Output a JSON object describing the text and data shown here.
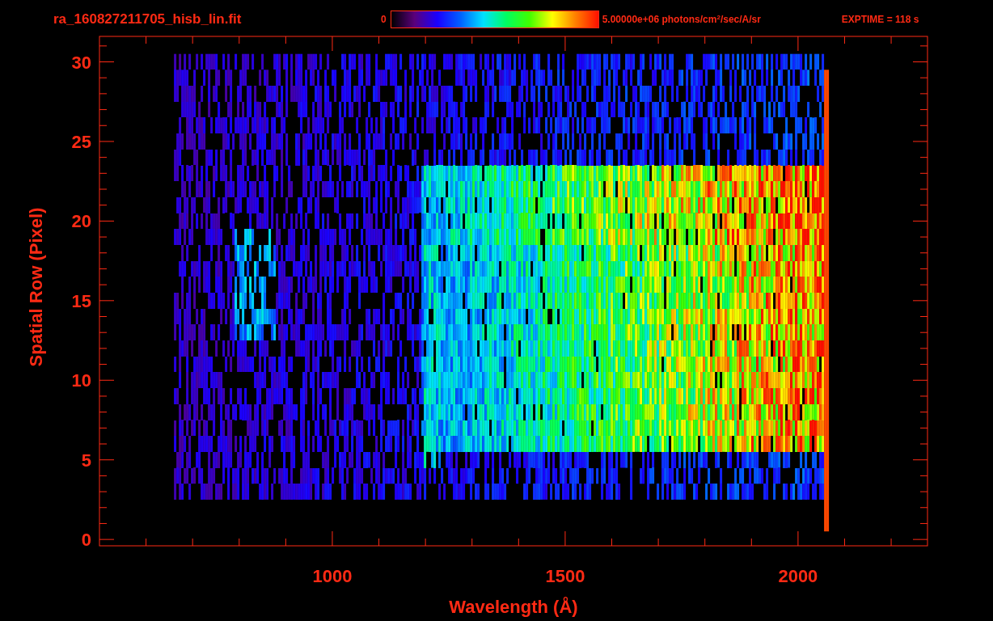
{
  "title": "ra_160827211705_hisb_lin.fit",
  "colorbar": {
    "min_label": "0",
    "max_label": "5.00000e+06 photons/cm$^{2}$/sec/A/sr"
  },
  "exposure": "EXPTIME = 118 s",
  "plot": {
    "xlabel": "Wavelength (Å)",
    "ylabel": "Spatial Row (Pixel)",
    "xtick_labels": [
      "1000",
      "1500",
      "2000"
    ],
    "ytick_labels": [
      "30",
      "25",
      "20",
      "15",
      "10",
      "5",
      "0"
    ]
  }
}
